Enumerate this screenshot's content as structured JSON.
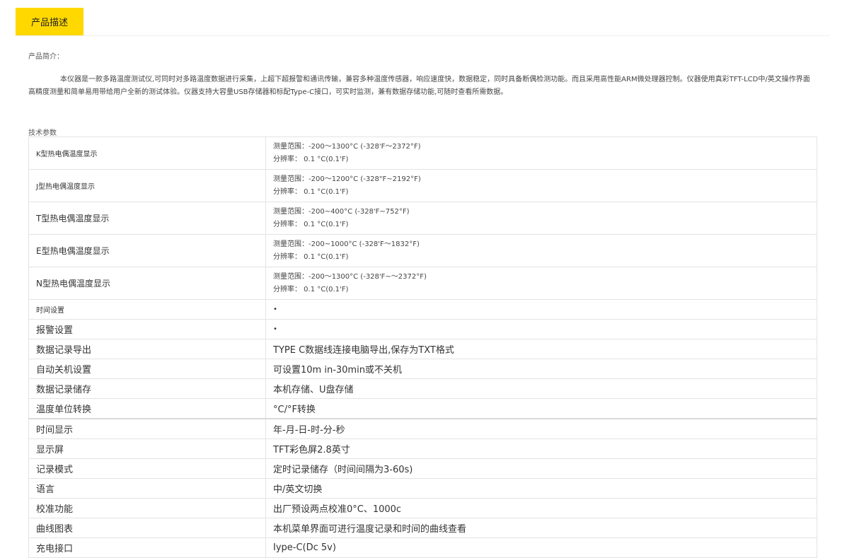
{
  "tab": {
    "label": "产品描述"
  },
  "intro": {
    "label": "产品简介：",
    "text": "本仪器是一款多路温度测试仪,可同时对多路温度数据进行采集，上超下超报警和通讯传输，兼容多种温度传感器，响应速度快，数据稳定，同时具备断偶检测功能。而且采用高性能ARM微处理器控制。仪器使用真彩TFT-LCD中/英文操作界面高精度测量和简单易用带给用户全新的测试体验。仪器支持大容量USB存储器和标配Type-C接口，可实时监测，兼有数据存储功能,可随时查看所需数据。"
  },
  "specs": {
    "label": "技术参数",
    "thermocouples": [
      {
        "name": "K型热电偶温度显示",
        "range": " 测量范围：-200～1300°C (-328'F～2372°F)",
        "resolution": "分辨率：  0.1 °C(0.1'F)"
      },
      {
        "name": "J型热电偶温度显示",
        "range": "测量范围：-200～1200°C (-328\"F~2192°F)",
        "resolution": "分辨率：  0.1 °C(0.1'F)"
      },
      {
        "name": "T型热电偶温度显示",
        "range": "测量范围：-200~400°C (-328'F~752°F)",
        "resolution": "分辨率：  0.1 °C(0.1'F)"
      },
      {
        "name": "E型热电偶温度显示",
        "range": "测量范围：-200~1000°C (-328'F～1832°F)",
        "resolution": "分辨率：  0.1 °C(0.1'F)"
      },
      {
        "name": "N型热电偶温度显示",
        "range": "测量范围：-200～1300°C (-328'F~～2372°F)",
        "resolution": "分辨率：  0.1 °C(0.1'F)"
      }
    ],
    "rows": [
      {
        "name": "时间设置",
        "value": "•"
      },
      {
        "name": "报警设置",
        "value": "•"
      },
      {
        "name": "数据记录导出",
        "value": "TYPE C数据线连接电脑导出,保存为TXT格式"
      },
      {
        "name": "自动关机设置",
        "value": "可设置10m in-30min或不关机"
      },
      {
        "name": "数据记录储存",
        "value": "本机存储、U盘存储"
      },
      {
        "name": "温度单位转换",
        "value": "°C/°F转换"
      },
      {
        "name": "时间显示",
        "value": "年-月-日-时-分-秒"
      },
      {
        "name": "显示屏",
        "value": "TFT彩色屏2.8英寸"
      },
      {
        "name": "记录模式",
        "value": "定时记录储存（时间间隔为3-60s)"
      },
      {
        "name": "语言",
        "value": "中/英文切换"
      },
      {
        "name": "校准功能",
        "value": "出厂预设两点校准0°C、1000c"
      },
      {
        "name": "曲线图表",
        "value": "本机菜单界面可进行温度记录和时间的曲线查看"
      },
      {
        "name": "充电接口",
        "value": "Iype-C(Dc 5v)"
      }
    ]
  }
}
